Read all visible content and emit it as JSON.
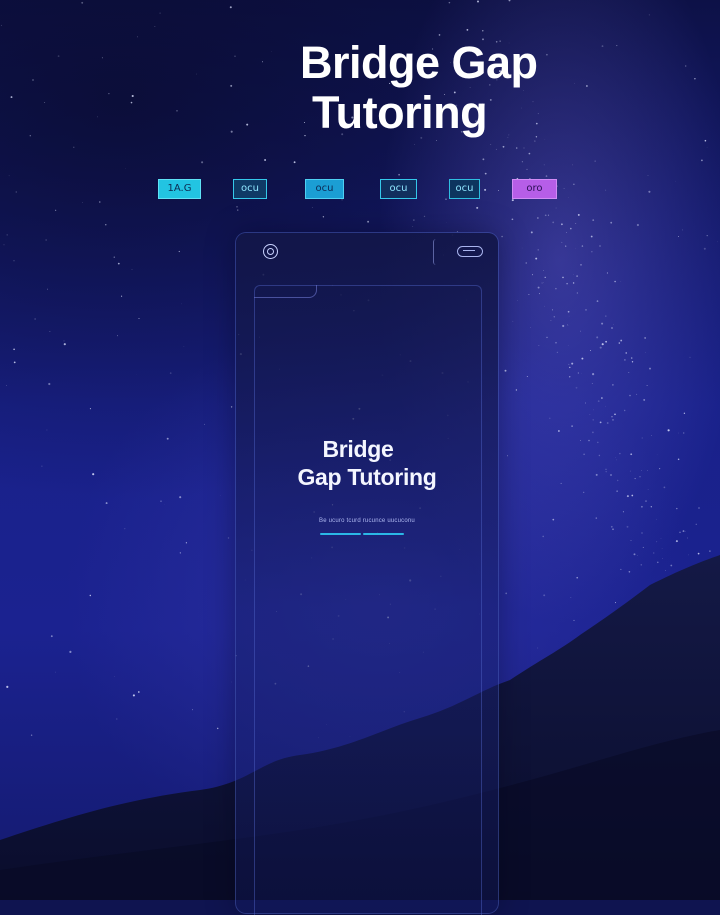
{
  "hero": {
    "title_line1": "Bridge Gap",
    "title_line2": "Tutoring"
  },
  "nav": {
    "chips": [
      {
        "label": "1A.G",
        "color": "#22c4e2"
      },
      {
        "label": "ocu",
        "color": "#0f3a66"
      },
      {
        "label": "ocu",
        "color": "#1b9ed4"
      },
      {
        "label": "ocu",
        "color": "#112f5e"
      },
      {
        "label": "ocu",
        "color": "#0d355f"
      },
      {
        "label": "oro",
        "color": "#b65ee8"
      }
    ]
  },
  "device": {
    "title_line1": "Bridge",
    "title_line2": "Gap Tutoring",
    "subtitle": "Be ucuro tcurd rucunce uucuconu",
    "accent": "#2bb7e6"
  },
  "colors": {
    "background": "#1b2290",
    "text": "#ffffff"
  }
}
